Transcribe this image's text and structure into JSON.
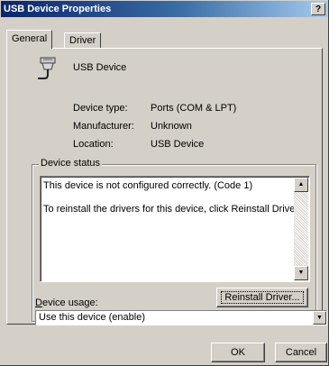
{
  "window": {
    "title": "USB Device Properties",
    "help_label": "?"
  },
  "tabs": [
    {
      "label": "General",
      "active": true
    },
    {
      "label": "Driver",
      "active": false
    }
  ],
  "device": {
    "name": "USB Device",
    "icon": "usb-port-icon",
    "properties": [
      {
        "label": "Device type:",
        "value": "Ports (COM & LPT)"
      },
      {
        "label": "Manufacturer:",
        "value": "Unknown"
      },
      {
        "label": "Location:",
        "value": "USB Device"
      }
    ]
  },
  "status": {
    "title": "Device status",
    "line1": "This device is not configured correctly. (Code 1)",
    "line2": "To reinstall the drivers for this device, click Reinstall Driver.",
    "reinstall_label": "Reinstall Driver..."
  },
  "usage": {
    "label": "Device usage:",
    "selected": "Use this device (enable)"
  },
  "buttons": {
    "ok": "OK",
    "cancel": "Cancel"
  }
}
